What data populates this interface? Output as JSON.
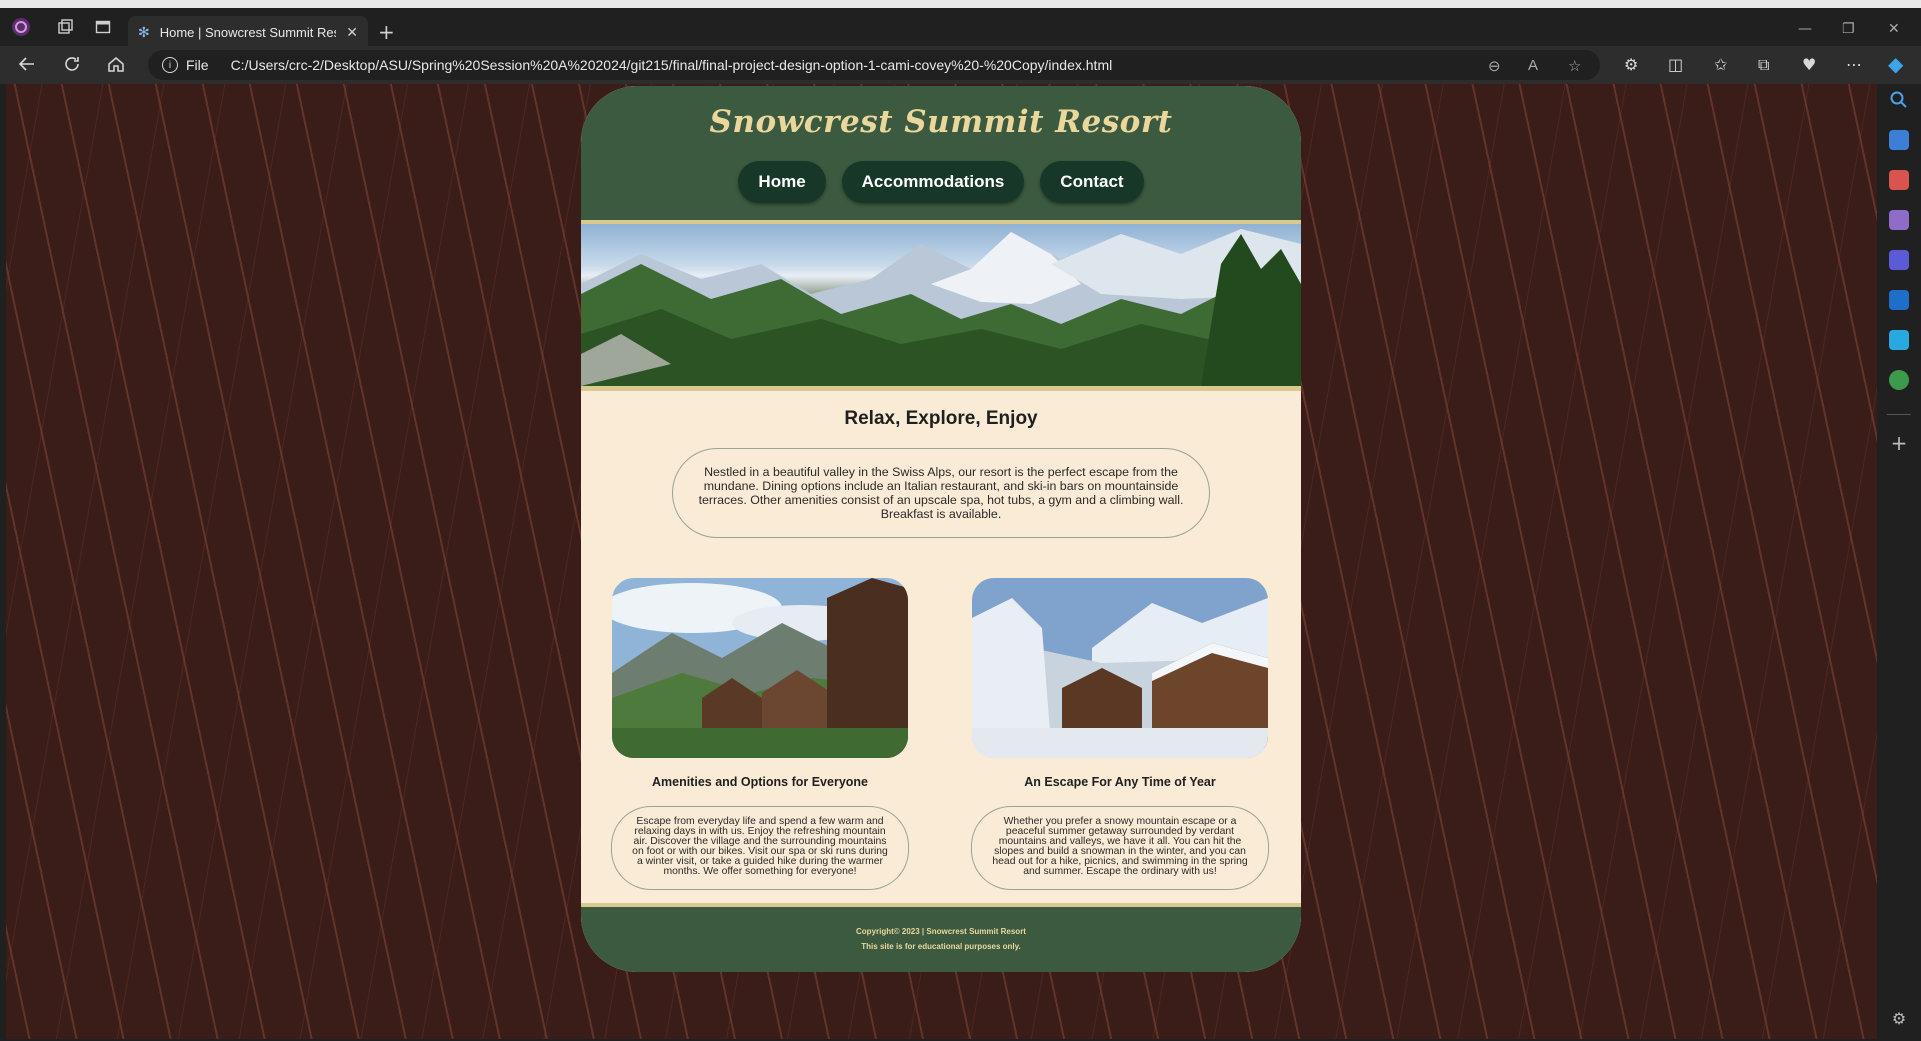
{
  "browser": {
    "tab_title": "Home | Snowcrest Summit Resor",
    "address_scheme": "File",
    "address_url": "C:/Users/crc-2/Desktop/ASU/Spring%20Session%20A%202024/git215/final/final-project-design-option-1-cami-covey%20-%20Copy/index.html"
  },
  "site": {
    "title": "Snowcrest Summit Resort",
    "nav": [
      "Home",
      "Accommodations",
      "Contact"
    ],
    "main_heading": "Relax, Explore, Enjoy",
    "intro": "Nestled in a beautiful valley in the Swiss Alps, our resort is the perfect escape from the mundane. Dining options include an Italian restaurant, and ski-in bars on mountainside terraces. Other amenities consist of an upscale spa, hot tubs, a gym and a climbing wall. Breakfast is available.",
    "columns": [
      {
        "title": "Amenities and Options for Everyone",
        "text": "Escape from everyday life and spend a few warm and relaxing days in with us. Enjoy the refreshing mountain air. Discover the village and the surrounding mountains on foot or with our bikes. Visit our spa or ski runs during a winter visit, or take a guided hike during the warmer months. We offer something for everyone!"
      },
      {
        "title": "An Escape For Any Time of Year",
        "text": "Whether you prefer a snowy mountain escape or a peaceful summer getaway surrounded by verdant mountains and valleys, we have it all. You can hit the slopes and build a snowman in the winter, and you can head out for a hike, picnics, and swimming in the spring and summer. Escape the ordinary with us!"
      }
    ],
    "footer": {
      "copyright": "Copyright© 2023 | Snowcrest Summit Resort",
      "disclaimer": "This site is for educational purposes only."
    }
  },
  "colors": {
    "header_green": "#3c5a40",
    "nav_pill": "#173828",
    "title_gold": "#ead79c",
    "page_cream": "#faebd6",
    "background_brown": "#3a1d18"
  }
}
